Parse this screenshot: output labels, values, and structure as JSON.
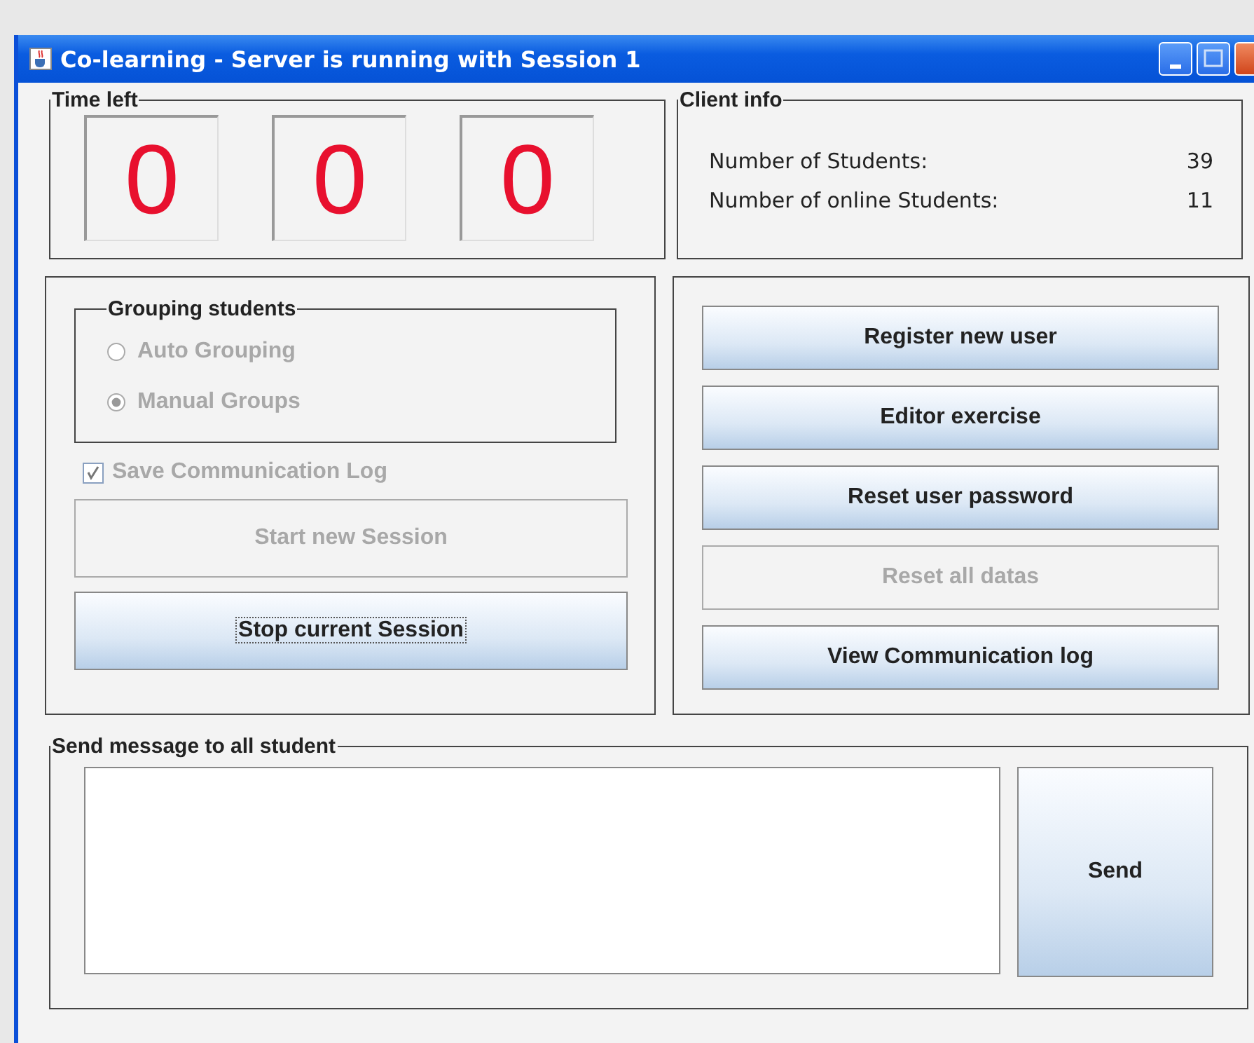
{
  "window": {
    "title": "Co-learning - Server is running with Session 1"
  },
  "time_left": {
    "title": "Time left",
    "digits": [
      "0",
      "0",
      "0"
    ]
  },
  "client_info": {
    "title": "Client info",
    "rows": [
      {
        "label": "Number of Students:",
        "value": "39"
      },
      {
        "label": "Number of online Students:",
        "value": "11"
      }
    ]
  },
  "grouping": {
    "title": "Grouping students",
    "options": [
      {
        "label": "Auto Grouping",
        "selected": false,
        "disabled": true
      },
      {
        "label": "Manual Groups",
        "selected": true,
        "disabled": true
      }
    ]
  },
  "save_log": {
    "label": "Save Communication Log",
    "checked": true,
    "disabled": true
  },
  "session_buttons": [
    {
      "label": "Start new Session",
      "disabled": true,
      "focused": false
    },
    {
      "label": "Stop current Session",
      "disabled": false,
      "focused": true
    }
  ],
  "admin_buttons": [
    {
      "label": "Register new user",
      "disabled": false
    },
    {
      "label": "Editor exercise",
      "disabled": false
    },
    {
      "label": "Reset user password",
      "disabled": false
    },
    {
      "label": "Reset all datas",
      "disabled": true
    },
    {
      "label": "View Communication log",
      "disabled": false
    }
  ],
  "message": {
    "title": "Send message to all student",
    "send_button": "Send"
  }
}
